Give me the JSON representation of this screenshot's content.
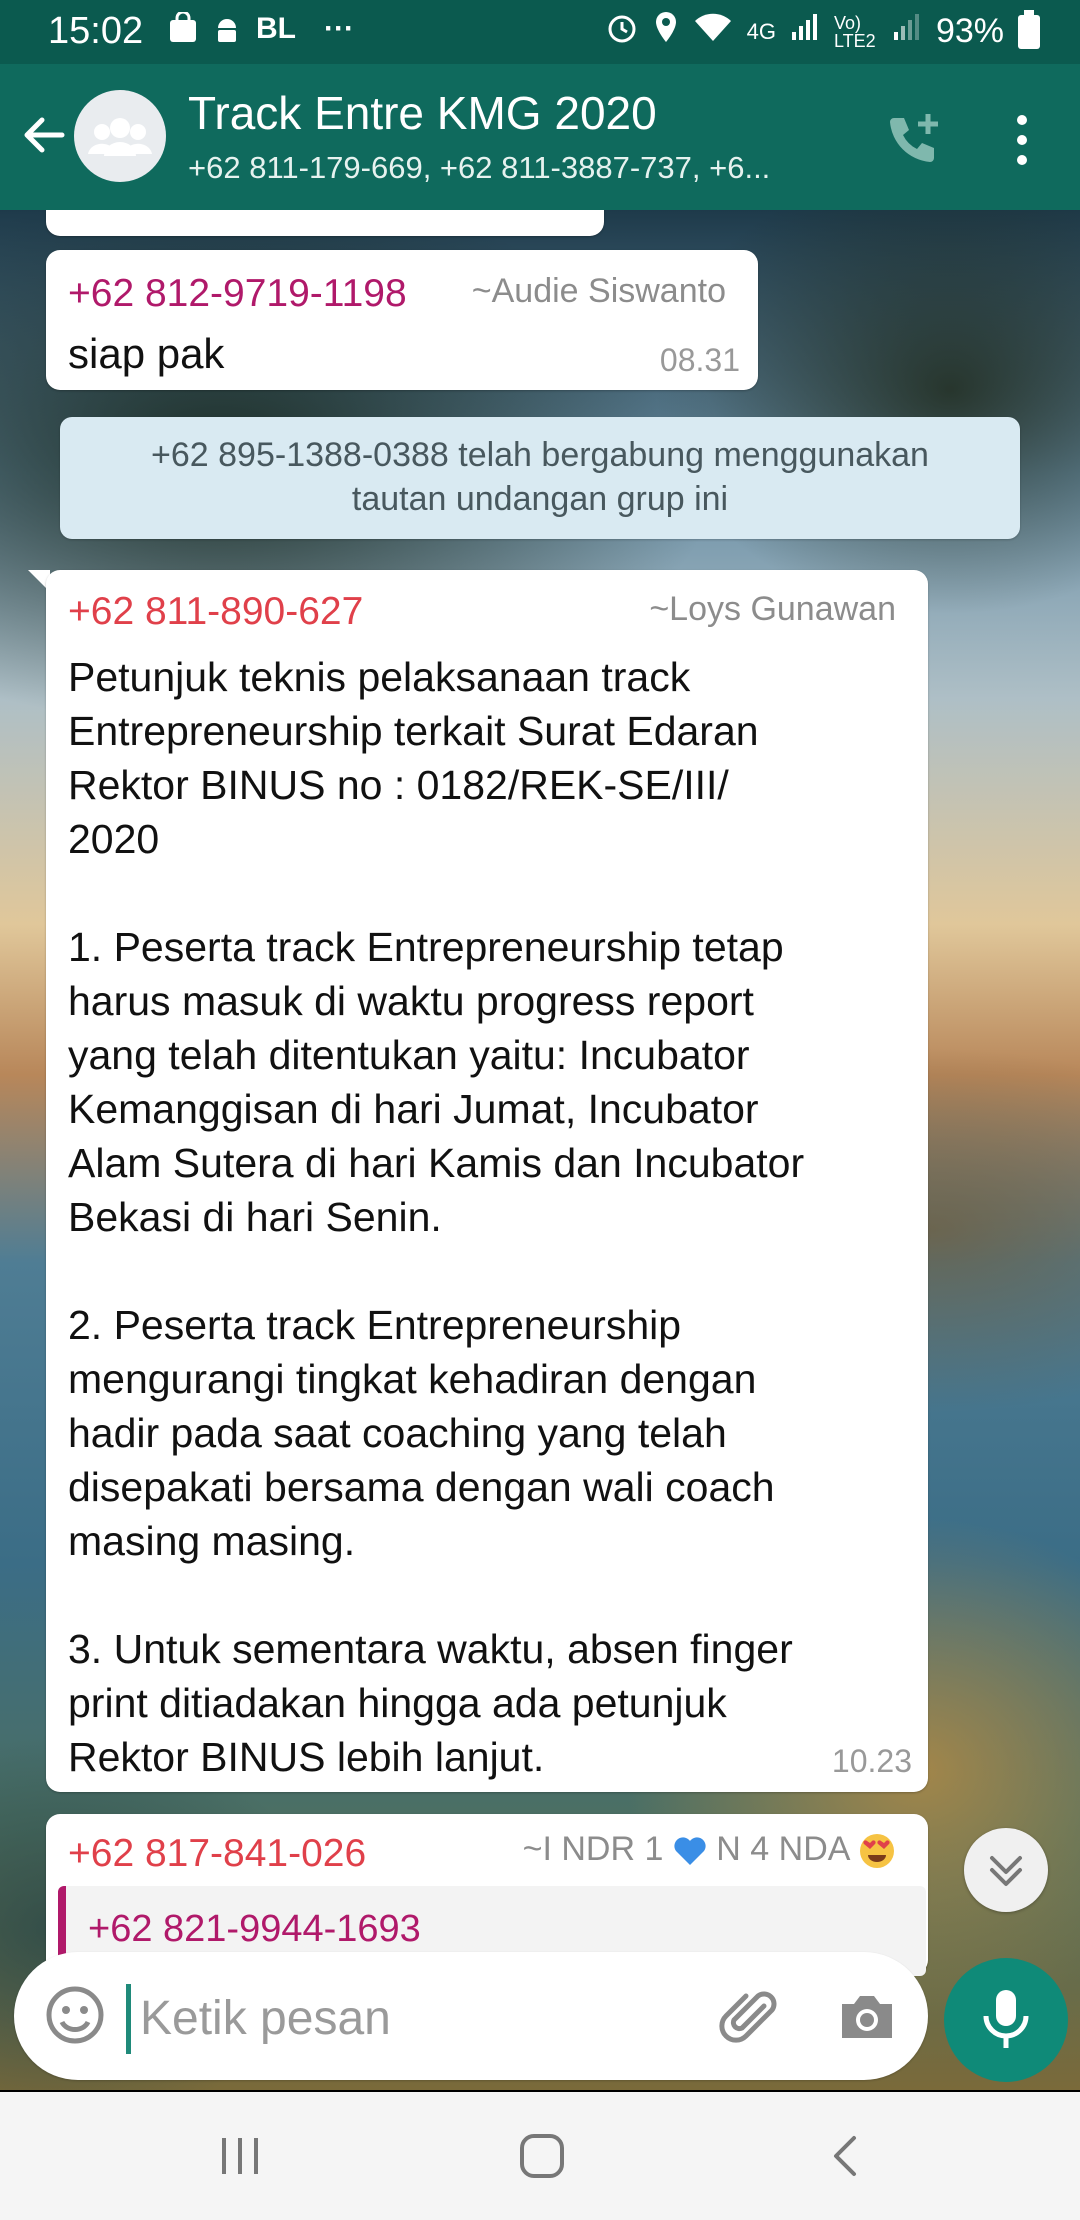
{
  "status_bar": {
    "time": "15:02",
    "left_text": "BL",
    "more": "···",
    "network": "4G",
    "volte": "Vo) LTE2",
    "battery": "93%"
  },
  "header": {
    "title": "Track Entre KMG 2020",
    "subtitle": "+62 811-179-669, +62 811-3887-737, +6..."
  },
  "messages": [
    {
      "sender": "+62 812-9719-1198",
      "alias": "~Audie Siswanto",
      "text": "siap pak",
      "time": "08.31"
    }
  ],
  "system_message": {
    "line1": "+62 895-1388-0388 telah bergabung menggunakan",
    "line2": "tautan undangan grup ini"
  },
  "long_message": {
    "sender": "+62 811-890-627",
    "alias": "~Loys Gunawan",
    "lines": [
      "Petunjuk teknis pelaksanaan track",
      "Entrepreneurship terkait Surat Edaran",
      "Rektor BINUS no : 0182/REK-SE/III/",
      "2020",
      "",
      "1. Peserta track Entrepreneurship tetap",
      "harus masuk di waktu progress report",
      "yang telah ditentukan yaitu: Incubator",
      "Kemanggisan di hari Jumat, Incubator",
      "Alam Sutera di hari Kamis dan Incubator",
      "Bekasi di hari Senin.",
      "",
      "2. Peserta track Entrepreneurship",
      "mengurangi tingkat kehadiran dengan",
      "hadir pada saat coaching yang telah",
      "disepakati bersama dengan wali coach",
      "masing masing.",
      "",
      "3. Untuk sementara waktu, absen finger",
      "print ditiadakan hingga ada petunjuk",
      "Rektor BINUS lebih lanjut."
    ],
    "time": "10.23"
  },
  "partial_message": {
    "sender": "+62 817-841-026",
    "alias_a": "~I NDR 1",
    "alias_b": "N 4 NDA",
    "quoted_sender": "+62 821-9944-1693"
  },
  "input": {
    "placeholder": "Ketik pesan"
  },
  "colors": {
    "header": "#0f6a5d",
    "status_bar": "#0b5a4f",
    "mic_button": "#0f8a78",
    "sender_magenta": "#b0196a",
    "sender_red": "#e0404a",
    "system_bg": "#d9eaf2"
  },
  "icons": [
    "back-arrow-icon",
    "group-avatar-icon",
    "add-call-icon",
    "more-vert-icon",
    "emoji-icon",
    "attach-icon",
    "camera-icon",
    "mic-icon",
    "scroll-down-icon",
    "recents-icon",
    "home-icon",
    "back-nav-icon"
  ]
}
